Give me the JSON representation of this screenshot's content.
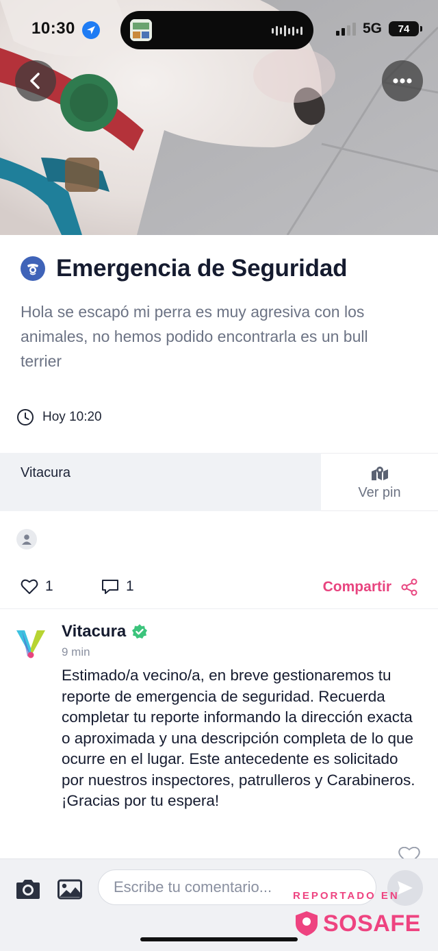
{
  "status_bar": {
    "time": "10:30",
    "network": "5G",
    "battery": "74"
  },
  "hero": {
    "alt": "bull terrier photo"
  },
  "header": {
    "back_icon": "chevron-left-icon",
    "more_icon": "ellipsis-icon"
  },
  "report": {
    "category_icon": "police-badge-icon",
    "title": "Emergencia de Seguridad",
    "description": "Hola se escapó mi perra es muy agresiva con los animales, no hemos podido encontrarla es un bull terrier",
    "time": "Hoy 10:20",
    "location": "Vitacura",
    "pin_label": "Ver pin"
  },
  "actions": {
    "likes": "1",
    "comments": "1",
    "share_label": "Compartir"
  },
  "comment": {
    "author": "Vitacura",
    "ago": "9 min",
    "body": "Estimado/a vecino/a, en breve gestionaremos tu reporte de emergencia de seguridad. Recuerda completar tu reporte informando la dirección exacta o aproximada y una descripción completa de lo que ocurre en el lugar. Este antecedente es solicitado por nuestros inspectores, patrulleros y Carabineros. ¡Gracias por tu espera!"
  },
  "composer": {
    "placeholder": "Escribe tu comentario..."
  },
  "watermark": {
    "top": "REPORTADO EN",
    "brand": "SOSAFE"
  },
  "colors": {
    "accent": "#e8447f",
    "badge": "#3f63b8",
    "verified": "#3cc47c"
  }
}
